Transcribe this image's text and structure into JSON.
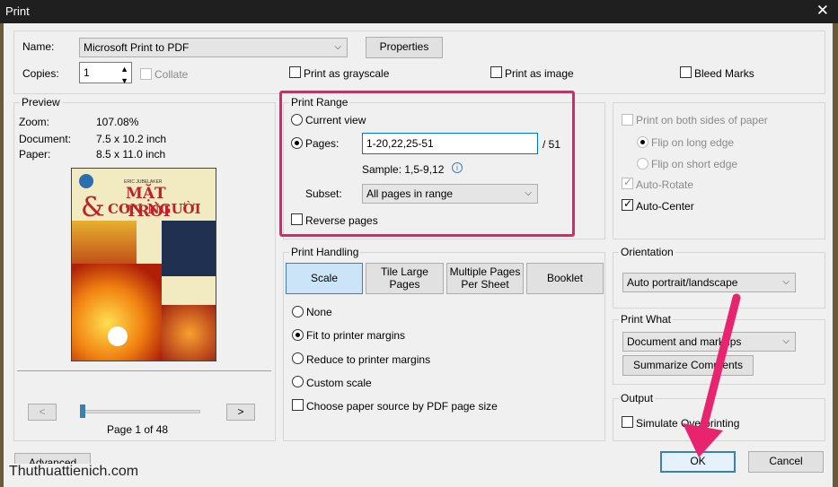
{
  "window": {
    "title": "Print",
    "close_icon": "close-icon"
  },
  "printer": {
    "name_label": "Name:",
    "name_value": "Microsoft Print to PDF",
    "properties_label": "Properties",
    "copies_label": "Copies:",
    "copies_value": "1",
    "collate_label": "Collate",
    "grayscale_label": "Print as grayscale",
    "image_label": "Print as image",
    "bleed_label": "Bleed Marks"
  },
  "preview": {
    "title": "Preview",
    "zoom_label": "Zoom:",
    "zoom_value": "107.08%",
    "document_label": "Document:",
    "document_value": "7.5 x 10.2 inch",
    "paper_label": "Paper:",
    "paper_value": "8.5 x 11.0 inch",
    "thumb_small": "ERIC JUBELAKER",
    "thumb_title_1": "MẶT TRỜI",
    "thumb_title_2": "CON NGƯỜI",
    "prev_button": "<",
    "next_button": ">",
    "page_status": "Page 1 of 48",
    "slider_position": 0.02
  },
  "print_range": {
    "title": "Print Range",
    "current_view": "Current view",
    "pages_label": "Pages:",
    "pages_value": "1-20,22,25-51",
    "total_pages": "/ 51",
    "sample": "Sample: 1,5-9,12",
    "subset_label": "Subset:",
    "subset_value": "All pages in range",
    "reverse_label": "Reverse pages"
  },
  "handling": {
    "title": "Print Handling",
    "tabs": [
      "Scale",
      "Tile Large Pages",
      "Multiple Pages Per Sheet",
      "Booklet"
    ],
    "active_tab": "Scale",
    "opt_none": "None",
    "opt_fit": "Fit to printer margins",
    "opt_reduce": "Reduce to printer margins",
    "opt_custom": "Custom scale",
    "paper_source": "Choose paper source by PDF page size"
  },
  "duplex": {
    "both_sides": "Print on both sides of paper",
    "flip_long": "Flip on long edge",
    "flip_short": "Flip on short edge",
    "auto_rotate": "Auto-Rotate",
    "auto_center": "Auto-Center"
  },
  "orientation": {
    "title": "Orientation",
    "value": "Auto portrait/landscape"
  },
  "print_what": {
    "title": "Print What",
    "value": "Document and markups",
    "summarize_label": "Summarize Comments"
  },
  "output": {
    "title": "Output",
    "simulate_label": "Simulate Overprinting"
  },
  "footer": {
    "advanced_label": "Advanced",
    "ok_label": "OK",
    "cancel_label": "Cancel",
    "watermark": "Thuthuattienich.com"
  },
  "colors": {
    "highlight": "#e0246a",
    "accent": "#3c7fb1",
    "selected_tab": "#cce4f7"
  }
}
